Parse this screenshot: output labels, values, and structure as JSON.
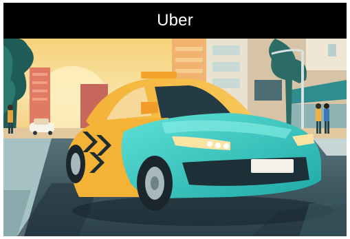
{
  "header": {
    "brand": "Uber"
  },
  "illustration": {
    "subject": "taxi-car",
    "colors": {
      "teal": "#2fc7c2",
      "yellow": "#f2a52a",
      "sky_warm": "#f7c76a",
      "header": "#000000"
    }
  }
}
